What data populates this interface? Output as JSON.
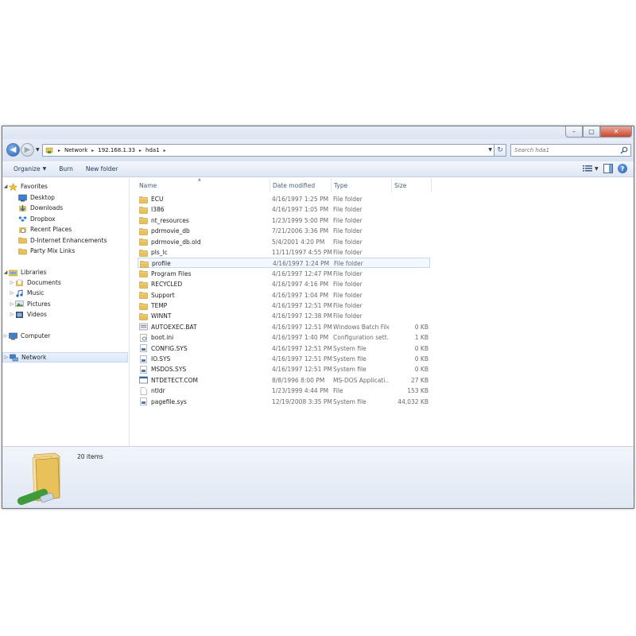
{
  "window": {
    "controls": {
      "minimize": "–",
      "maximize": "▢",
      "close": "✕"
    }
  },
  "nav": {
    "back_icon": "back-arrow-icon",
    "forward_icon": "forward-arrow-icon",
    "breadcrumbs": [
      "Network",
      "192.168.1.33",
      "hda1"
    ],
    "search_placeholder": "Search hda1"
  },
  "toolbar": {
    "organize": "Organize",
    "burn": "Burn",
    "new_folder": "New folder"
  },
  "sidebar": {
    "favorites": {
      "label": "Favorites",
      "items": [
        "Desktop",
        "Downloads",
        "Dropbox",
        "Recent Places",
        "D-Internet Enhancements",
        "Party Mix Links"
      ]
    },
    "libraries": {
      "label": "Libraries",
      "items": [
        "Documents",
        "Music",
        "Pictures",
        "Videos"
      ]
    },
    "computer": "Computer",
    "network": "Network"
  },
  "columns": {
    "name": "Name",
    "date": "Date modified",
    "type": "Type",
    "size": "Size"
  },
  "files": [
    {
      "name": "ECU",
      "date": "4/16/1997 1:25 PM",
      "type": "File folder",
      "size": "",
      "kind": "folder"
    },
    {
      "name": "I386",
      "date": "4/16/1997 1:05 PM",
      "type": "File folder",
      "size": "",
      "kind": "folder"
    },
    {
      "name": "nt_resources",
      "date": "1/23/1999 5:00 PM",
      "type": "File folder",
      "size": "",
      "kind": "folder"
    },
    {
      "name": "pdrmovie_db",
      "date": "7/21/2006 3:36 PM",
      "type": "File folder",
      "size": "",
      "kind": "folder"
    },
    {
      "name": "pdrmovie_db.old",
      "date": "5/4/2001 4:20 PM",
      "type": "File folder",
      "size": "",
      "kind": "folder"
    },
    {
      "name": "pls_lc",
      "date": "11/11/1997 4:55 PM",
      "type": "File folder",
      "size": "",
      "kind": "folder"
    },
    {
      "name": "profile",
      "date": "4/16/1997 1:24 PM",
      "type": "File folder",
      "size": "",
      "kind": "folder",
      "selected": true
    },
    {
      "name": "Program Files",
      "date": "4/16/1997 12:47 PM",
      "type": "File folder",
      "size": "",
      "kind": "folder"
    },
    {
      "name": "RECYCLED",
      "date": "4/16/1997 4:16 PM",
      "type": "File folder",
      "size": "",
      "kind": "folder"
    },
    {
      "name": "Support",
      "date": "4/16/1997 1:04 PM",
      "type": "File folder",
      "size": "",
      "kind": "folder"
    },
    {
      "name": "TEMP",
      "date": "4/16/1997 12:51 PM",
      "type": "File folder",
      "size": "",
      "kind": "folder"
    },
    {
      "name": "WINNT",
      "date": "4/16/1997 12:38 PM",
      "type": "File folder",
      "size": "",
      "kind": "folder"
    },
    {
      "name": "AUTOEXEC.BAT",
      "date": "4/16/1997 12:51 PM",
      "type": "Windows Batch File",
      "size": "0 KB",
      "kind": "batch"
    },
    {
      "name": "boot.ini",
      "date": "4/16/1997 1:40 PM",
      "type": "Configuration sett...",
      "size": "1 KB",
      "kind": "config"
    },
    {
      "name": "CONFIG.SYS",
      "date": "4/16/1997 12:51 PM",
      "type": "System file",
      "size": "0 KB",
      "kind": "system"
    },
    {
      "name": "IO.SYS",
      "date": "4/16/1997 12:51 PM",
      "type": "System file",
      "size": "0 KB",
      "kind": "system"
    },
    {
      "name": "MSDOS.SYS",
      "date": "4/16/1997 12:51 PM",
      "type": "System file",
      "size": "0 KB",
      "kind": "system"
    },
    {
      "name": "NTDETECT.COM",
      "date": "8/8/1996 8:00 PM",
      "type": "MS-DOS Applicati...",
      "size": "27 KB",
      "kind": "app"
    },
    {
      "name": "ntldr",
      "date": "1/23/1999 4:44 PM",
      "type": "File",
      "size": "153 KB",
      "kind": "file"
    },
    {
      "name": "pagefile.sys",
      "date": "12/19/2008 3:35 PM",
      "type": "System file",
      "size": "44,032 KB",
      "kind": "system"
    }
  ],
  "details": {
    "item_count": "20 items"
  },
  "colors": {
    "folder": "#e8c15a",
    "accent": "#2b64b4",
    "selection": "#d9e8fa"
  }
}
